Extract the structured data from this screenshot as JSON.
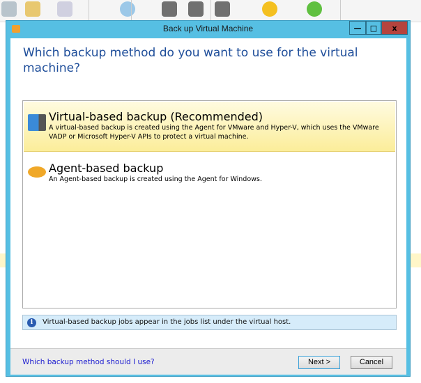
{
  "dialog": {
    "title": "Back up Virtual Machine",
    "controls": {
      "minimize": "—",
      "maximize": "□",
      "close": "x"
    },
    "heading": "Which backup method do you want to use for the virtual machine?",
    "options": [
      {
        "title": "Virtual-based backup (Recommended)",
        "description": "A virtual-based backup is created using the Agent for VMware and Hyper-V, which uses the VMware VADP or Microsoft Hyper-V APIs to protect a virtual machine.",
        "icon": "virtual-server-icon",
        "selected": true
      },
      {
        "title": "Agent-based backup",
        "description": "An Agent-based backup is created using the Agent for Windows.",
        "icon": "disk-icon",
        "selected": false
      }
    ],
    "info": "Virtual-based backup jobs appear in the jobs list under the virtual host.",
    "help_link": "Which backup method should I use?",
    "next_label": "Next >",
    "cancel_label": "Cancel"
  },
  "colors": {
    "title_bar": "#56bfe3",
    "close": "#b5443e",
    "heading": "#1f4e9a",
    "selected": "#fbed9a",
    "link": "#2020d0"
  }
}
